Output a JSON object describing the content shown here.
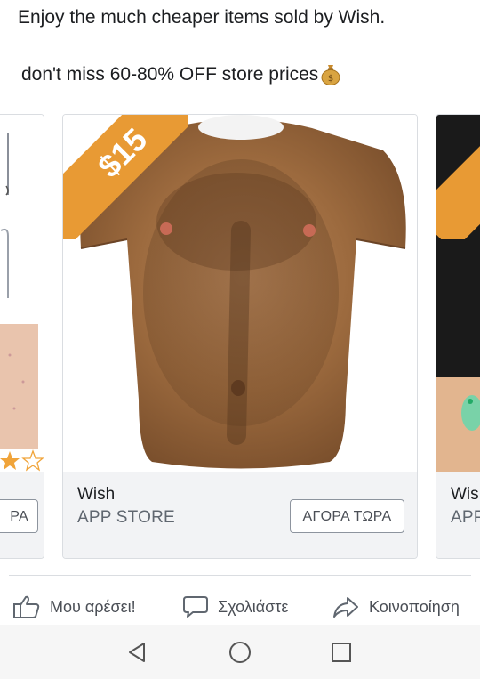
{
  "post": {
    "line1": "Enjoy the much cheaper items sold by Wish.",
    "line2": "don't miss 60-80% OFF store prices"
  },
  "carousel": {
    "prev_card": {
      "cta_label": "ΡΑ"
    },
    "main_card": {
      "price_tag": "$15",
      "title": "Wish",
      "subtitle": "APP STORE",
      "cta_label": "ΑΓΟΡΑ ΤΩΡΑ"
    },
    "next_card": {
      "price_tag": "$",
      "title": "Wis",
      "subtitle": "APP"
    }
  },
  "actions": {
    "like_label": "Μου αρέσει!",
    "comment_label": "Σχολιάστε",
    "share_label": "Κοινοποίηση"
  },
  "colors": {
    "price_banner": "#e89a34",
    "cta_border": "#8d949e",
    "footer_bg": "#f2f3f5"
  }
}
